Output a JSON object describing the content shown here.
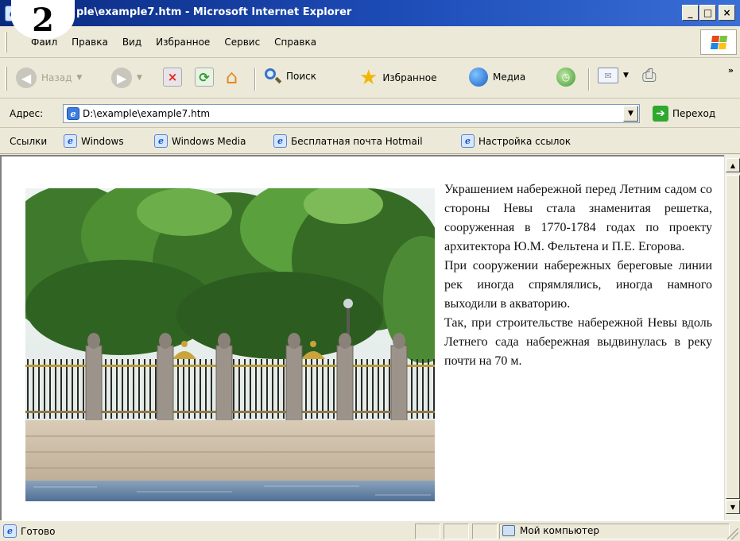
{
  "window": {
    "title": "ple\\example7.htm - Microsoft Internet Explorer",
    "badge_number": "2",
    "buttons": {
      "minimize": "_",
      "maximize": "□",
      "close": "×"
    }
  },
  "menu": {
    "items": [
      "Файл",
      "Правка",
      "Вид",
      "Избранное",
      "Сервис",
      "Справка"
    ]
  },
  "toolbar": {
    "back": "Назад",
    "search": "Поиск",
    "favorites": "Избранное",
    "media": "Медиа",
    "overflow": "»"
  },
  "address": {
    "label": "Адрес:",
    "value": "D:\\example\\example7.htm",
    "go": "Переход"
  },
  "links": {
    "label": "Ссылки",
    "items": [
      "Windows",
      "Windows Media",
      "Бесплатная почта Hotmail",
      "Настройка ссылок"
    ]
  },
  "content": {
    "paragraphs": [
      "Украшением набережной перед Летним садом со стороны Невы стала знаменитая решетка, сооруженная в 1770-1784 годах по проекту архитектора Ю.М. Фельтена и П.Е. Егорова.",
      "При сооружении набережных береговые линии рек иногда спрямлялись, иногда намного выходили в акваторию.",
      "Так, при строительстве набережной Невы вдоль Летнего сада набережная выдвинулась в реку почти на 70 м."
    ]
  },
  "status": {
    "text": "Готово",
    "zone": "Мой компьютер"
  }
}
